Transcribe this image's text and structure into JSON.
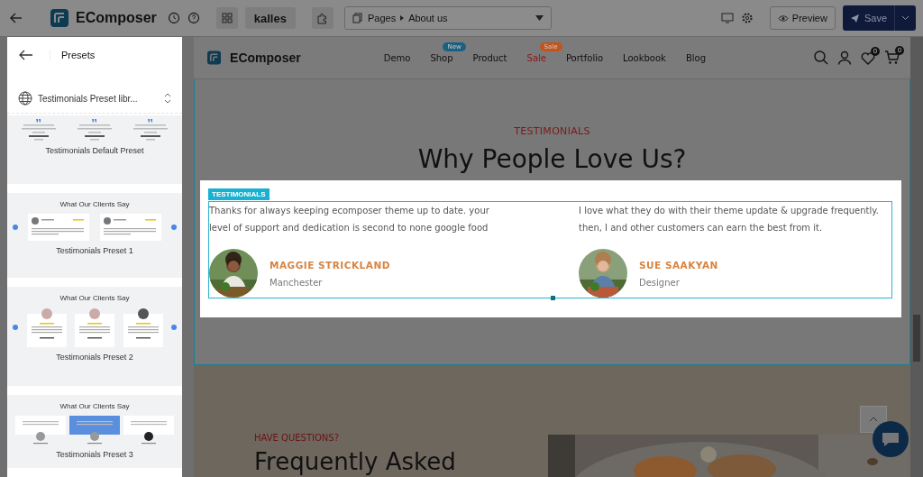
{
  "topbar": {
    "brand": "EComposer",
    "theme": "kalles",
    "page_selector": {
      "label": "Pages",
      "value": "About us"
    },
    "preview": "Preview",
    "save": "Save"
  },
  "sidebar": {
    "title": "Presets",
    "library": "Testimonials Preset libr...",
    "presets": [
      {
        "kind": "columns",
        "title": "Testimonials Default Preset"
      },
      {
        "kind": "slider",
        "heading": "What Our Clients Say",
        "title": "Testimonials Preset 1"
      },
      {
        "kind": "avatars",
        "heading": "What Our Clients Say",
        "title": "Testimonials Preset 2"
      },
      {
        "kind": "highlight",
        "heading": "What Our Clients Say",
        "title": "Testimonials Preset 3"
      }
    ]
  },
  "site": {
    "brand": "EComposer",
    "nav": [
      {
        "label": "Demo",
        "highlight": false
      },
      {
        "label": "Shop",
        "badge": {
          "text": "New",
          "color": "#1d5f80"
        },
        "highlight": false
      },
      {
        "label": "Product",
        "highlight": false
      },
      {
        "label": "Sale",
        "badge": {
          "text": "Sale",
          "color": "#c4541b"
        },
        "highlight": true
      },
      {
        "label": "Portfolio",
        "highlight": false
      },
      {
        "label": "Lookbook",
        "highlight": false
      },
      {
        "label": "Blog",
        "highlight": false
      }
    ],
    "wishlist_count": "0",
    "cart_count": "0"
  },
  "section": {
    "eyebrow": "TESTIMONIALS",
    "heading": "Why People Love Us?",
    "tag": "TESTIMONIALS",
    "testimonials": [
      {
        "quote": "Thanks for always keeping ecomposer theme up to date. your level of support and dedication is second to none google food",
        "name": "MAGGIE STRICKLAND",
        "role": "Manchester"
      },
      {
        "quote": "I love what they do with their theme update & upgrade frequently. then, I  and other customers can earn the best from it.",
        "name": "SUE SAAKYAN",
        "role": "Designer"
      }
    ]
  },
  "faq": {
    "eyebrow": "HAVE QUESTIONS?",
    "heading": "Frequently Asked"
  }
}
